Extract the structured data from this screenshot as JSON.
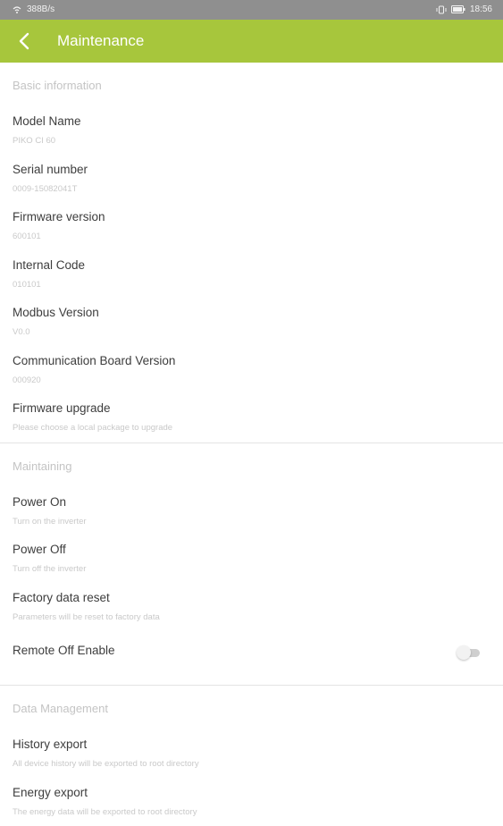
{
  "status_bar": {
    "speed": "388B/s",
    "time": "18:56"
  },
  "app_bar": {
    "title": "Maintenance"
  },
  "basic_information": {
    "header": "Basic information",
    "items": [
      {
        "title": "Model Name",
        "subtitle": "PIKO CI 60"
      },
      {
        "title": "Serial number",
        "subtitle": "0009-15082041T"
      },
      {
        "title": "Firmware version",
        "subtitle": "600101"
      },
      {
        "title": "Internal Code",
        "subtitle": "010101"
      },
      {
        "title": "Modbus Version",
        "subtitle": "V0.0"
      },
      {
        "title": "Communication Board Version",
        "subtitle": "000920"
      },
      {
        "title": "Firmware upgrade",
        "subtitle": "Please choose a local package to upgrade"
      }
    ]
  },
  "maintaining": {
    "header": "Maintaining",
    "items": [
      {
        "title": "Power On",
        "subtitle": "Turn on the inverter"
      },
      {
        "title": "Power Off",
        "subtitle": "Turn off the inverter"
      },
      {
        "title": "Factory data reset",
        "subtitle": "Parameters will be reset to factory data"
      }
    ],
    "remote_off": {
      "title": "Remote Off Enable",
      "enabled": false
    }
  },
  "data_management": {
    "header": "Data Management",
    "items": [
      {
        "title": "History export",
        "subtitle": "All device history will be exported to root directory"
      },
      {
        "title": "Energy export",
        "subtitle": "The energy data will be exported to root directory"
      }
    ]
  },
  "colors": {
    "accent": "#a7c63c",
    "status_bar": "#8f8f8f"
  }
}
